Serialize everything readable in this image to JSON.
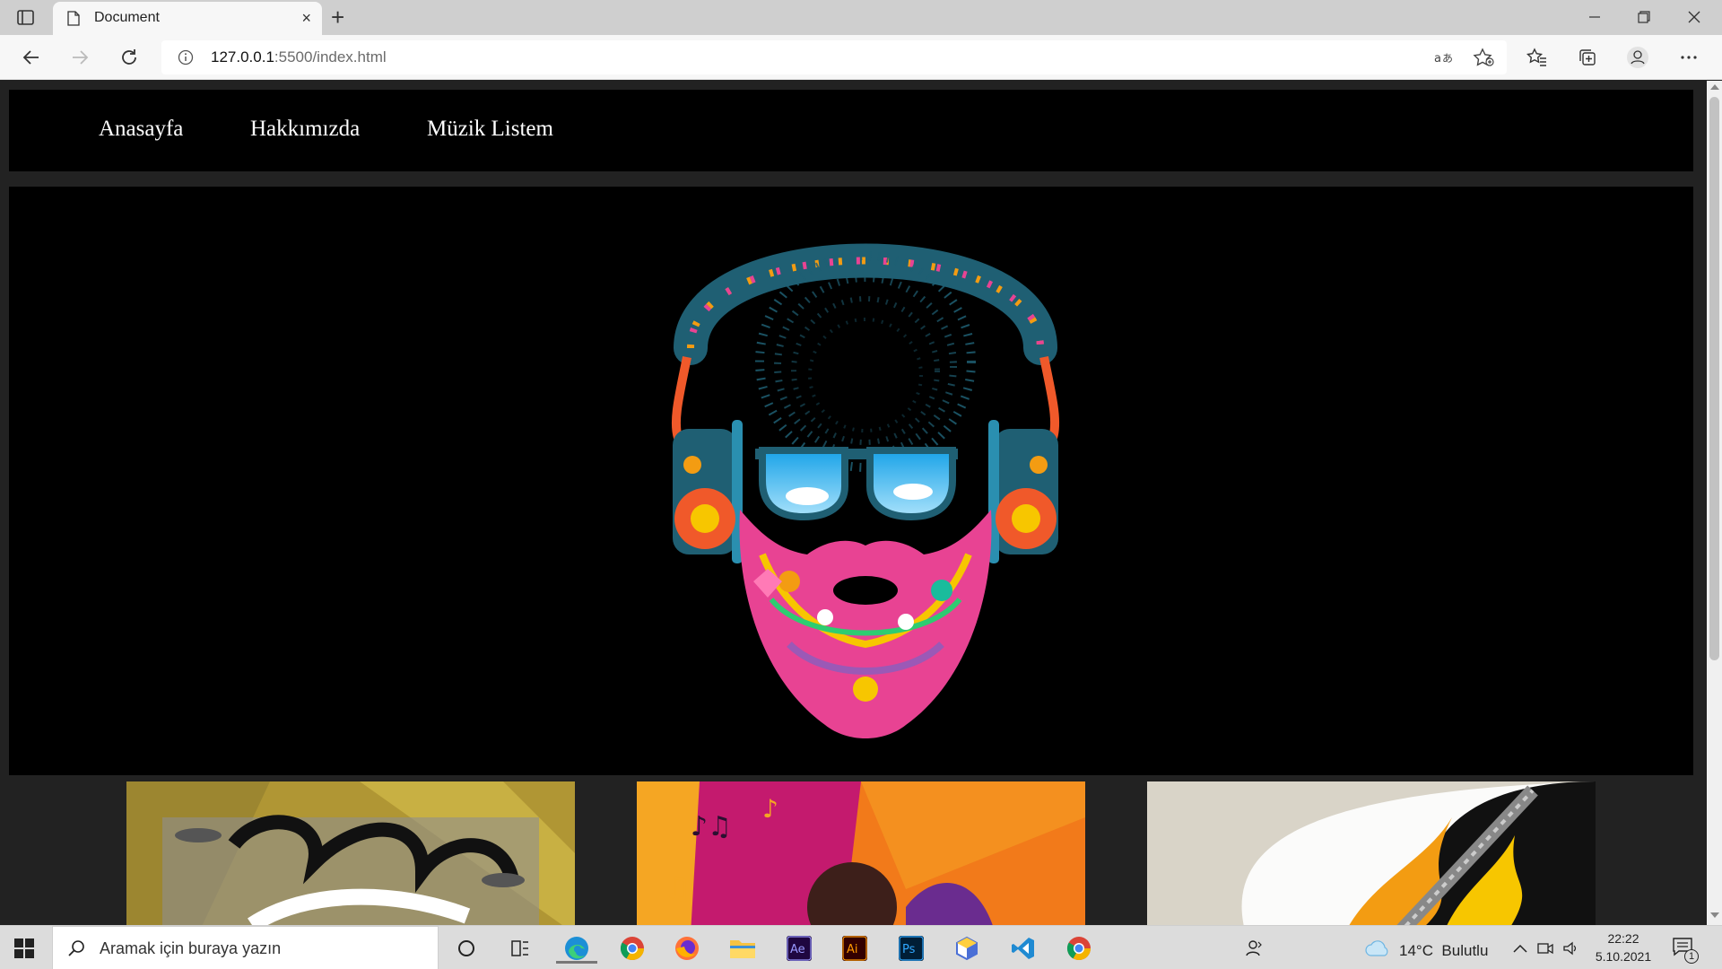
{
  "browser": {
    "tab_title": "Document",
    "new_tab_symbol": "+",
    "close_tab_symbol": "×",
    "url_host": "127.0.0.1",
    "url_rest": ":5500/index.html"
  },
  "site": {
    "nav": [
      {
        "label": "Anasayfa"
      },
      {
        "label": "Hakkımızda"
      },
      {
        "label": "Müzik Listem"
      }
    ]
  },
  "taskbar": {
    "search_placeholder": "Aramak için buraya yazın",
    "apps": [
      "task-view-icon",
      "edge-icon",
      "chrome-icon",
      "firefox-icon",
      "file-explorer-icon",
      "after-effects-icon",
      "illustrator-icon",
      "photoshop-icon",
      "app-cube-icon",
      "vscode-icon",
      "chrome-icon"
    ],
    "ae_label": "Ae",
    "ai_label": "Ai",
    "ps_label": "Ps",
    "weather": "14°C  Bulutlu",
    "time": "22:22",
    "date": "5.10.2021",
    "notification_count": "1"
  },
  "colors": {
    "page_bg": "#222222",
    "nav_bg": "#000000",
    "hero_bg": "#000000",
    "nav_text": "#ffffff"
  }
}
